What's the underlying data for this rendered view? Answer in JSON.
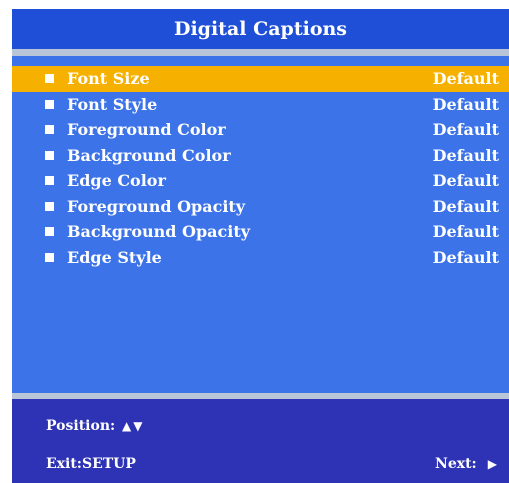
{
  "title": "Digital Captions",
  "colors": {
    "panel": "#3D73E8",
    "title_bar": "#1E4FD6",
    "separator": "#B9C6D8",
    "highlight": "#F5B000",
    "footer": "#2E33B5",
    "text": "#FFFFFF"
  },
  "menu": {
    "items": [
      {
        "label": "Font Size",
        "value": "Default",
        "selected": true
      },
      {
        "label": "Font Style",
        "value": "Default",
        "selected": false
      },
      {
        "label": "Foreground Color",
        "value": "Default",
        "selected": false
      },
      {
        "label": "Background Color",
        "value": "Default",
        "selected": false
      },
      {
        "label": "Edge Color",
        "value": "Default",
        "selected": false
      },
      {
        "label": "Foreground Opacity",
        "value": "Default",
        "selected": false
      },
      {
        "label": "Background Opacity",
        "value": "Default",
        "selected": false
      },
      {
        "label": "Edge Style",
        "value": "Default",
        "selected": false
      }
    ]
  },
  "footer": {
    "position_label": "Position:",
    "position_icons": [
      "up-triangle-icon",
      "down-triangle-icon"
    ],
    "exit_label": "Exit:SETUP",
    "next_label": "Next:",
    "next_icon": "right-triangle-icon"
  }
}
